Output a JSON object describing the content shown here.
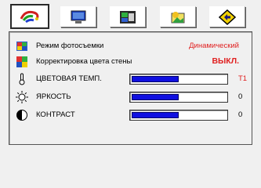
{
  "tabs": [
    {
      "icon": "color-swirl-icon",
      "active": true
    },
    {
      "icon": "monitor-icon",
      "active": false
    },
    {
      "icon": "settings-screen-icon",
      "active": false
    },
    {
      "icon": "picture-sun-icon",
      "active": false
    },
    {
      "icon": "diamond-arrow-icon",
      "active": false
    }
  ],
  "settings": {
    "photo_mode": {
      "label": "Режим фотосъемки",
      "value": "Динамический"
    },
    "wall_color": {
      "label": "Корректировка цвета стены",
      "value": "ВЫКЛ."
    },
    "color_temp": {
      "label": "ЦВЕТОВАЯ ТЕМП.",
      "value": "T1",
      "level": 0.5
    },
    "brightness": {
      "label": "ЯРКОСТЬ",
      "value": "0",
      "level": 0.5
    },
    "contrast": {
      "label": "КОНТРАСТ",
      "value": "0",
      "level": 0.5
    }
  },
  "colors": {
    "accent_red": "#e02020",
    "slider_fill": "#1010e0"
  }
}
